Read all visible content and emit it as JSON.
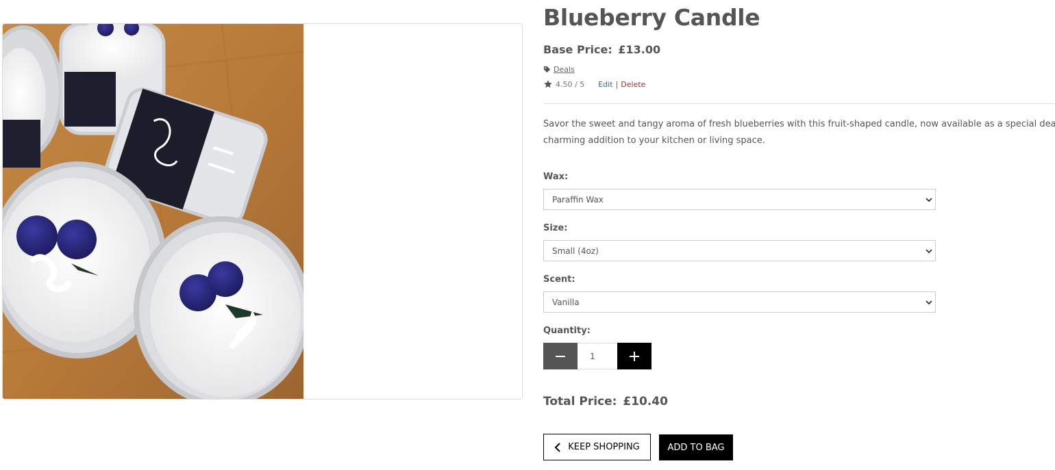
{
  "product": {
    "title": "Blueberry Candle",
    "base_price_label": "Base Price:",
    "base_price": "£13.00",
    "category": "Deals",
    "rating": "4.50 / 5",
    "edit_label": "Edit",
    "separator": "|",
    "delete_label": "Delete",
    "description_line1": "Savor the sweet and tangy aroma of fresh blueberries with this fruit-shaped candle, now available as a special deal! A",
    "description_line2": "charming addition to your kitchen or living space.",
    "image_alt": "Blueberry candles in glass jars"
  },
  "options": {
    "wax_label": "Wax:",
    "wax_value": "Paraffin Wax",
    "size_label": "Size:",
    "size_value": "Small (4oz)",
    "scent_label": "Scent:",
    "scent_value": "Vanilla",
    "quantity_label": "Quantity:",
    "quantity_value": "1"
  },
  "total": {
    "label": "Total Price:",
    "value": "£10.40"
  },
  "actions": {
    "keep_shopping": "KEEP SHOPPING",
    "add_to_bag": "ADD TO BAG"
  },
  "icons": {
    "tag": "tag-icon",
    "star": "star-icon",
    "chevron": "chevron-down-icon",
    "minus": "minus-icon",
    "plus": "plus-icon",
    "back": "chevron-left-icon"
  },
  "colors": {
    "text": "#555555",
    "edit_link": "#2a6aa8",
    "delete_link": "#a33232",
    "dark_button": "#000000",
    "minus_button": "#555555"
  }
}
